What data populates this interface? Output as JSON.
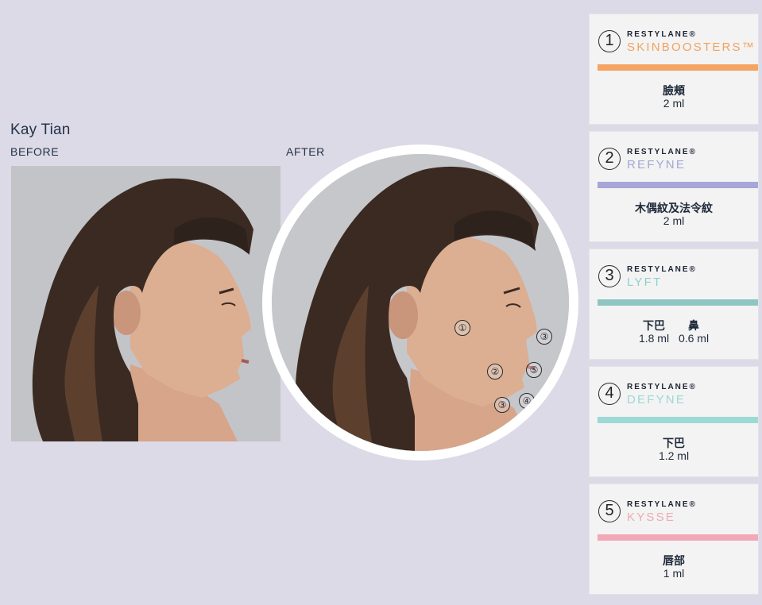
{
  "person": {
    "name": "Kay Tian"
  },
  "labels": {
    "before": "BEFORE",
    "after": "AFTER"
  },
  "markers": [
    "①",
    "③",
    "②",
    "⑤",
    "③",
    "④"
  ],
  "cards": [
    {
      "num": "1",
      "brand": "RESTYLANE®",
      "product": "SKINBOOSTERS™",
      "color": "#f2a35e",
      "bar": "#f5a463",
      "area": "臉頰",
      "volume": "2 ml"
    },
    {
      "num": "2",
      "brand": "RESTYLANE®",
      "product": "REFYNE",
      "color": "#a4a6d4",
      "bar": "#a7a6d6",
      "area": "木偶紋及法令紋",
      "volume": "2 ml"
    },
    {
      "num": "3",
      "brand": "RESTYLANE®",
      "product": "LYFT",
      "color": "#8fd0d0",
      "bar": "#8fc6c3",
      "area_a": "下巴",
      "volume_a": "1.8 ml",
      "area_b": "鼻",
      "volume_b": "0.6 ml"
    },
    {
      "num": "4",
      "brand": "RESTYLANE®",
      "product": "DEFYNE",
      "color": "#9cd8d6",
      "bar": "#9dd9d5",
      "area": "下巴",
      "volume": "1.2 ml"
    },
    {
      "num": "5",
      "brand": "RESTYLANE®",
      "product": "KYSSE",
      "color": "#f0a9b6",
      "bar": "#f2a8b6",
      "area": "唇部",
      "volume": "1 ml"
    }
  ]
}
